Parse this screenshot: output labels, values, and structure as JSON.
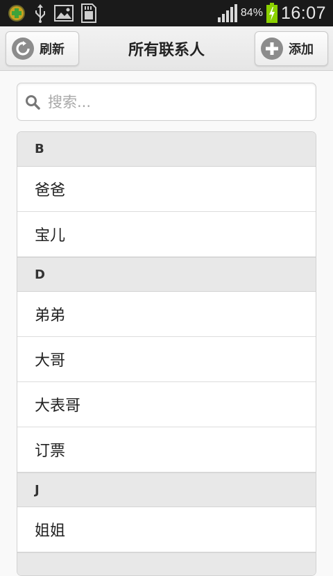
{
  "status_bar": {
    "battery_percent": "84%",
    "time": "16:07",
    "icons": [
      "app-notification-icon",
      "usb-icon",
      "image-icon",
      "sd-card-icon",
      "signal-icon",
      "battery-charging-icon"
    ]
  },
  "header": {
    "title": "所有联系人",
    "refresh_label": "刷新",
    "add_label": "添加"
  },
  "search": {
    "placeholder": "搜索...",
    "value": ""
  },
  "contacts": {
    "groups": [
      {
        "letter": "B",
        "items": [
          "爸爸",
          "宝儿"
        ]
      },
      {
        "letter": "D",
        "items": [
          "弟弟",
          "大哥",
          "大表哥",
          "订票"
        ]
      },
      {
        "letter": "J",
        "items": [
          "姐姐"
        ]
      }
    ]
  },
  "colors": {
    "status_bar_bg": "#1a1a1a",
    "header_bg": "#ececec",
    "divider_bg": "#e8e8e8",
    "battery_green": "#8bd100"
  }
}
